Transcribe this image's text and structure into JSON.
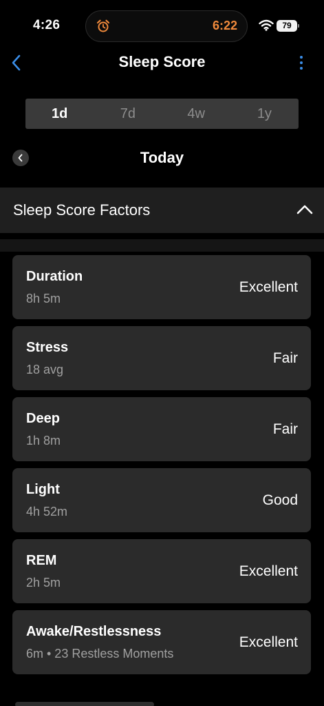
{
  "status_bar": {
    "time": "4:26",
    "alarm_time": "6:22",
    "battery": "79"
  },
  "nav": {
    "title": "Sleep Score"
  },
  "range_tabs": [
    {
      "label": "1d",
      "active": true
    },
    {
      "label": "7d",
      "active": false
    },
    {
      "label": "4w",
      "active": false
    },
    {
      "label": "1y",
      "active": false
    }
  ],
  "date_label": "Today",
  "section": {
    "title": "Sleep Score Factors"
  },
  "factors": [
    {
      "name": "Duration",
      "detail": "8h 5m",
      "rating": "Excellent"
    },
    {
      "name": "Stress",
      "detail": "18 avg",
      "rating": "Fair"
    },
    {
      "name": "Deep",
      "detail": "1h 8m",
      "rating": "Fair"
    },
    {
      "name": "Light",
      "detail": "4h 52m",
      "rating": "Good"
    },
    {
      "name": "REM",
      "detail": "2h 5m",
      "rating": "Excellent"
    },
    {
      "name": "Awake/Restlessness",
      "detail": "6m • 23 Restless Moments",
      "rating": "Excellent"
    }
  ],
  "colors": {
    "accent": "#3b8ee8",
    "alarm": "#f08a3c",
    "card": "#2b2b2b"
  }
}
